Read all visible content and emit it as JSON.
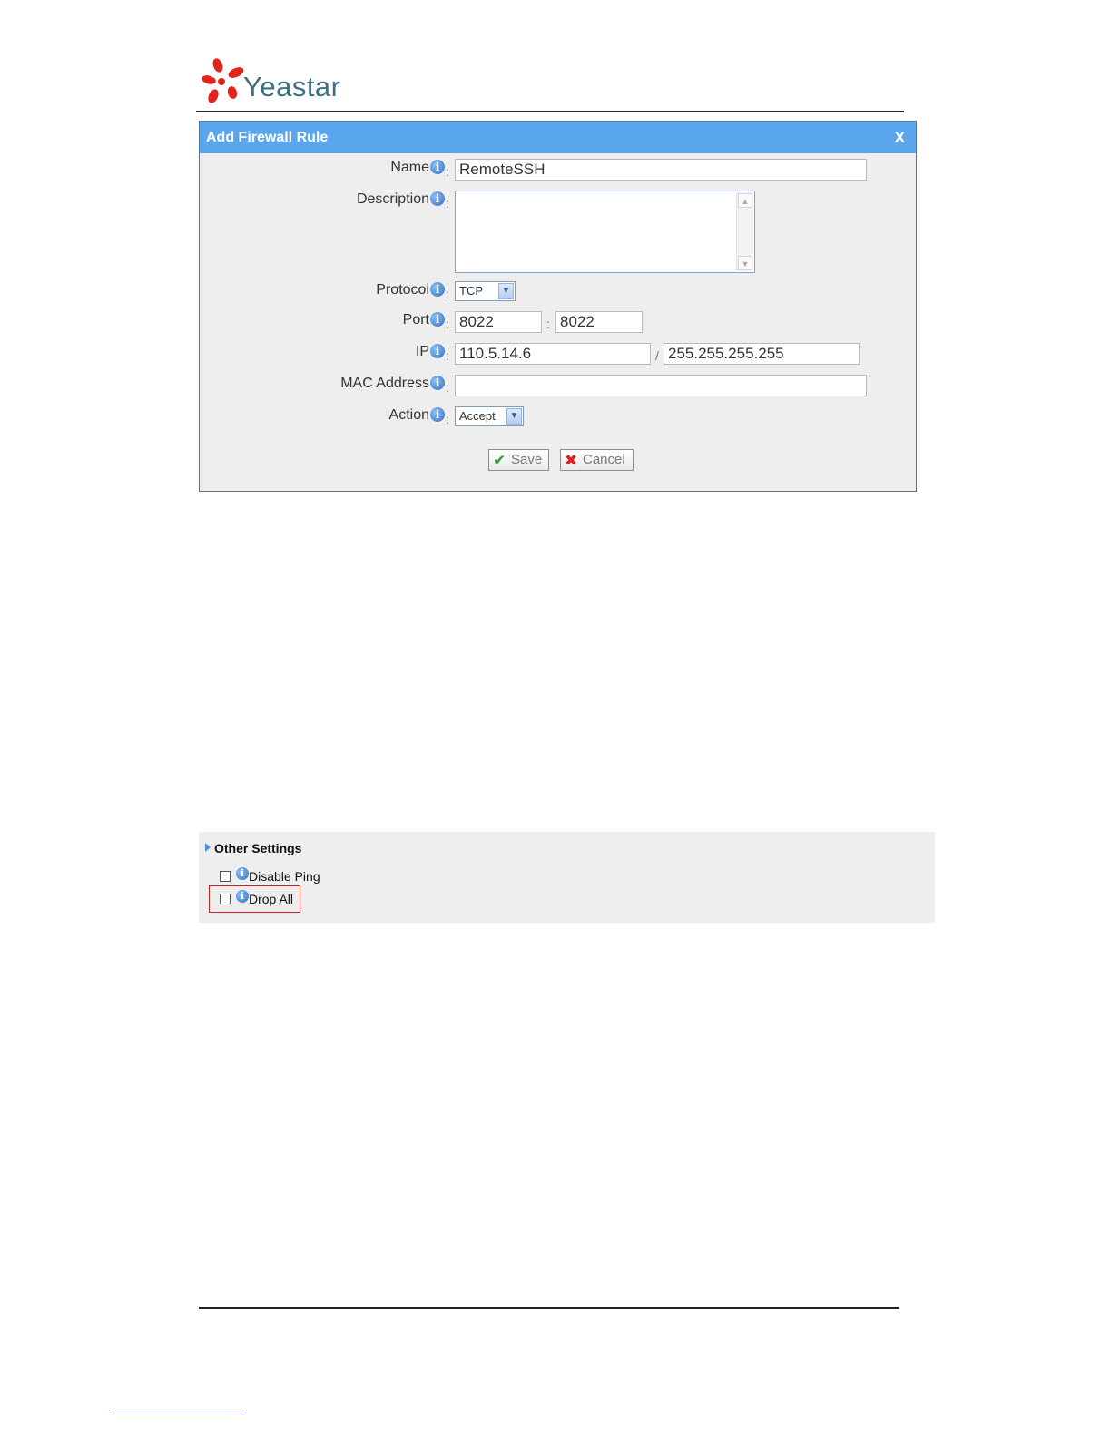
{
  "brand": {
    "name": "Yeastar"
  },
  "dialog": {
    "title": "Add Firewall Rule",
    "close_label": "X",
    "fields": {
      "name": {
        "label": "Name",
        "value": "RemoteSSH"
      },
      "description": {
        "label": "Description",
        "value": ""
      },
      "protocol": {
        "label": "Protocol",
        "value": "TCP"
      },
      "port": {
        "label": "Port",
        "value_from": "8022",
        "value_to": "8022",
        "separator": ":"
      },
      "ip": {
        "label": "IP",
        "address": "110.5.14.6",
        "mask": "255.255.255.255",
        "separator": "/"
      },
      "mac": {
        "label": "MAC Address",
        "value": ""
      },
      "action": {
        "label": "Action",
        "value": "Accept"
      }
    },
    "save_label": "Save",
    "cancel_label": "Cancel"
  },
  "other_settings": {
    "title": "Other Settings",
    "items": [
      {
        "label": "Disable Ping",
        "checked": false
      },
      {
        "label": "Drop All",
        "checked": false
      }
    ]
  },
  "colors": {
    "titlebar": "#5aa6ec",
    "panel": "#eeeeee",
    "highlight": "#cc2222"
  }
}
